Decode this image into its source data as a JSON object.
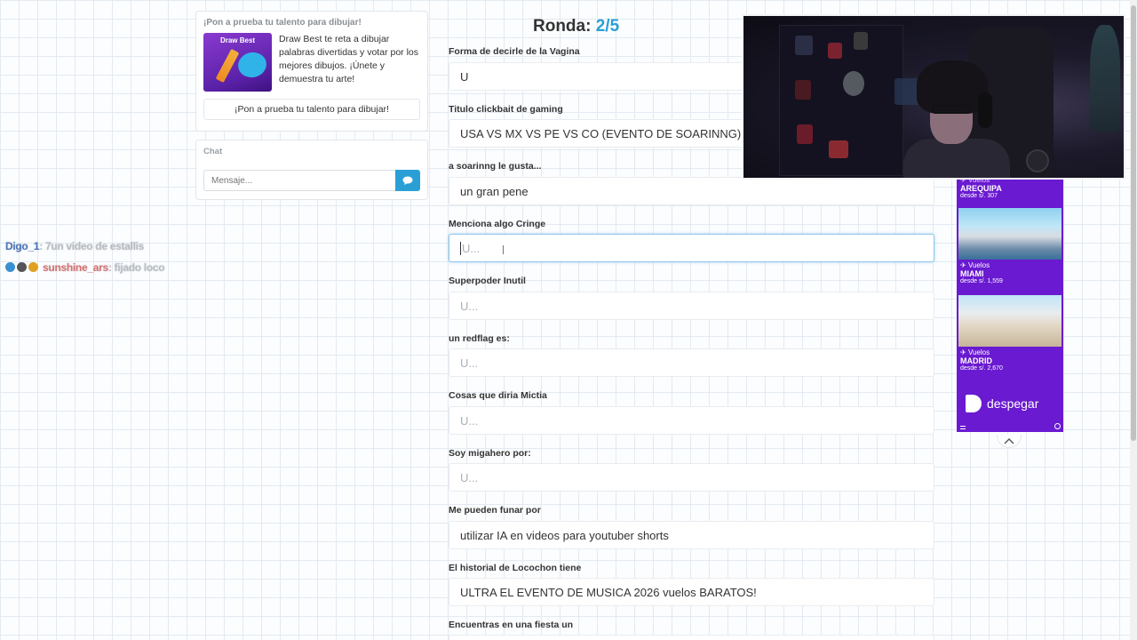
{
  "promo": {
    "header": "¡Pon a prueba tu talento para dibujar!",
    "thumb_title": "Draw Best",
    "description": "Draw Best te reta a dibujar palabras divertidas y votar por los mejores dibujos. ¡Únete y demuestra tu arte!",
    "cta": "¡Pon a prueba tu talento para dibujar!"
  },
  "chat": {
    "label": "Chat",
    "placeholder": "Mensaje...",
    "send_icon": "chat-bubble-icon"
  },
  "stream_chat": [
    {
      "user": "Digo_1",
      "message": ": 7un video de estallis"
    },
    {
      "user": "sunshine_ars",
      "message": ": fijado loco"
    }
  ],
  "round": {
    "label": "Ronda:",
    "value": "2/5"
  },
  "fields": [
    {
      "label": "Forma de decirle de la Vagina",
      "value": "U",
      "placeholder": ""
    },
    {
      "label": "Titulo clickbait de gaming",
      "value": "USA VS MX VS PE VS CO (EVENTO DE SOARINNG)",
      "placeholder": ""
    },
    {
      "label": "a soarinng le gusta...",
      "value": "un gran pene",
      "placeholder": ""
    },
    {
      "label": "Menciona algo Cringe",
      "value": "",
      "placeholder": "U..."
    },
    {
      "label": "Superpoder Inutil",
      "value": "",
      "placeholder": "U..."
    },
    {
      "label": "un redflag es:",
      "value": "",
      "placeholder": "U..."
    },
    {
      "label": "Cosas que diria Mictia",
      "value": "",
      "placeholder": "U..."
    },
    {
      "label": "Soy migahero por:",
      "value": "",
      "placeholder": "U..."
    },
    {
      "label": "Me pueden funar por",
      "value": "utilizar IA en videos para youtuber shorts",
      "placeholder": ""
    },
    {
      "label": "El historial de Locochon tiene",
      "value": "ULTRA EL EVENTO DE MUSICA 2026 vuelos BARATOS!",
      "placeholder": ""
    },
    {
      "label": "Encuentras en una fiesta un",
      "value": "",
      "placeholder": ""
    }
  ],
  "ad": {
    "offers": [
      {
        "tag": "Vuelos",
        "city": "AREQUIPA",
        "price": "desde s/. 307"
      },
      {
        "tag": "Vuelos",
        "city": "MIAMI",
        "price": "desde s/. 1,559"
      },
      {
        "tag": "Vuelos",
        "city": "MADRID",
        "price": "desde s/. 2,670"
      }
    ],
    "brand": "despegar",
    "colors": {
      "background": "#6a1ad0"
    }
  },
  "colors": {
    "accent": "#2a9fd6"
  }
}
